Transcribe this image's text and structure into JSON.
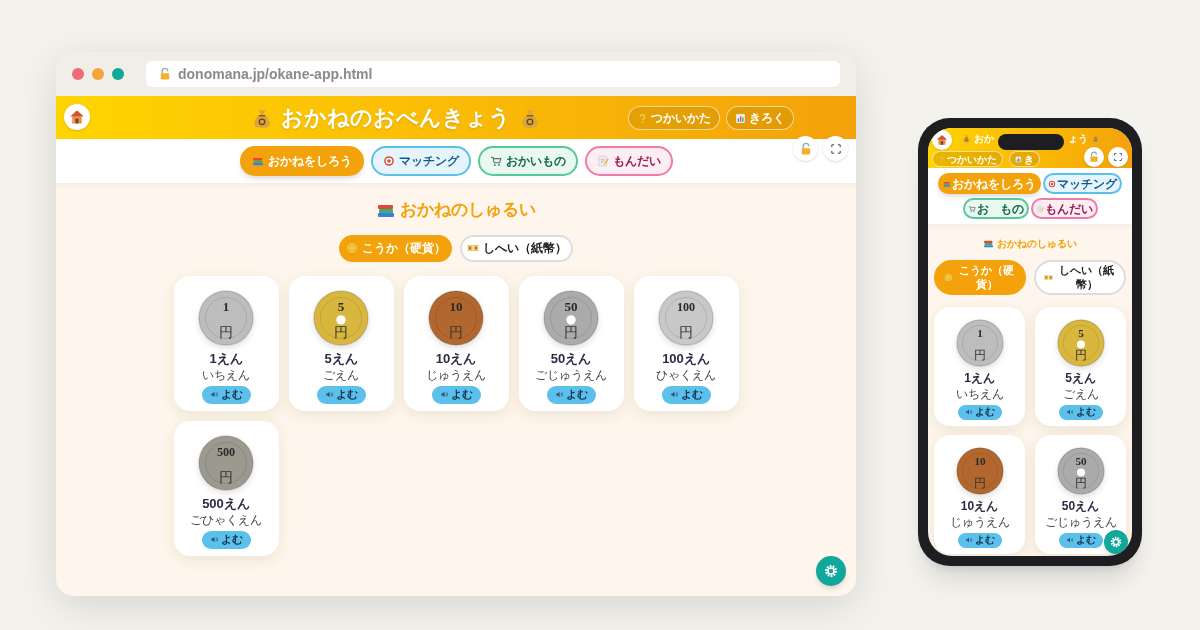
{
  "browser": {
    "url": "donomana.jp/okane-app.html"
  },
  "desktop_app": {
    "title": "おかねのおべんきょう",
    "header_buttons": [
      "つかいかた",
      "きろく"
    ],
    "tabs": [
      {
        "label": "おかねをしろう",
        "selected": true
      },
      {
        "label": "マッチング",
        "selected": false
      },
      {
        "label": "おかいもの",
        "selected": false
      },
      {
        "label": "もんだい",
        "selected": false
      }
    ],
    "section_title": "おかねのしゅるい",
    "toggle": [
      {
        "label": "こうか（硬貨）",
        "selected": true
      },
      {
        "label": "しへい（紙幣）",
        "selected": false
      }
    ],
    "coins": [
      {
        "value": "1",
        "unit": "円",
        "name": "1えん",
        "reading": "いちえん",
        "button": "よむ",
        "color": "#bdbdbd",
        "hole": false
      },
      {
        "value": "5",
        "unit": "円",
        "name": "5えん",
        "reading": "ごえん",
        "button": "よむ",
        "color": "#d9b73f",
        "hole": true
      },
      {
        "value": "10",
        "unit": "円",
        "name": "10えん",
        "reading": "じゅうえん",
        "button": "よむ",
        "color": "#b2672e",
        "hole": false
      },
      {
        "value": "50",
        "unit": "円",
        "name": "50えん",
        "reading": "ごじゅうえん",
        "button": "よむ",
        "color": "#ababab",
        "hole": true
      },
      {
        "value": "100",
        "unit": "円",
        "name": "100えん",
        "reading": "ひゃくえん",
        "button": "よむ",
        "color": "#c8c8c8",
        "hole": false
      },
      {
        "value": "500",
        "unit": "円",
        "name": "500えん",
        "reading": "ごひゃくえん",
        "button": "よむ",
        "color": "#9c9a8e",
        "hole": false
      }
    ]
  },
  "phone_app": {
    "title_start": "おか",
    "title_end": "ょう",
    "header_buttons": [
      "つかいかた",
      "き"
    ],
    "tabs": [
      {
        "label_parts": [
          "おかねをしろう"
        ],
        "selected": true
      },
      {
        "label_parts": [
          "マッチング"
        ],
        "selected": false
      },
      {
        "label_parts": [
          "お",
          "もの"
        ],
        "selected": false
      },
      {
        "label_parts": [
          "もんだい"
        ],
        "selected": false
      }
    ],
    "section_title": "おかねのしゅるい",
    "toggle": [
      {
        "label": "こうか（硬貨）",
        "selected": true
      },
      {
        "label": "しへい（紙幣）",
        "selected": false
      }
    ],
    "coins": [
      {
        "value": "1",
        "unit": "円",
        "name": "1えん",
        "reading": "いちえん",
        "button": "よむ",
        "color": "#bdbdbd",
        "hole": false
      },
      {
        "value": "5",
        "unit": "円",
        "name": "5えん",
        "reading": "ごえん",
        "button": "よむ",
        "color": "#d9b73f",
        "hole": true
      },
      {
        "value": "10",
        "unit": "円",
        "name": "10えん",
        "reading": "じゅうえん",
        "button": "よむ",
        "color": "#b2672e",
        "hole": false
      },
      {
        "value": "50",
        "unit": "円",
        "name": "50えん",
        "reading": "ごじゅうえん",
        "button": "よむ",
        "color": "#ababab",
        "hole": true
      }
    ]
  }
}
